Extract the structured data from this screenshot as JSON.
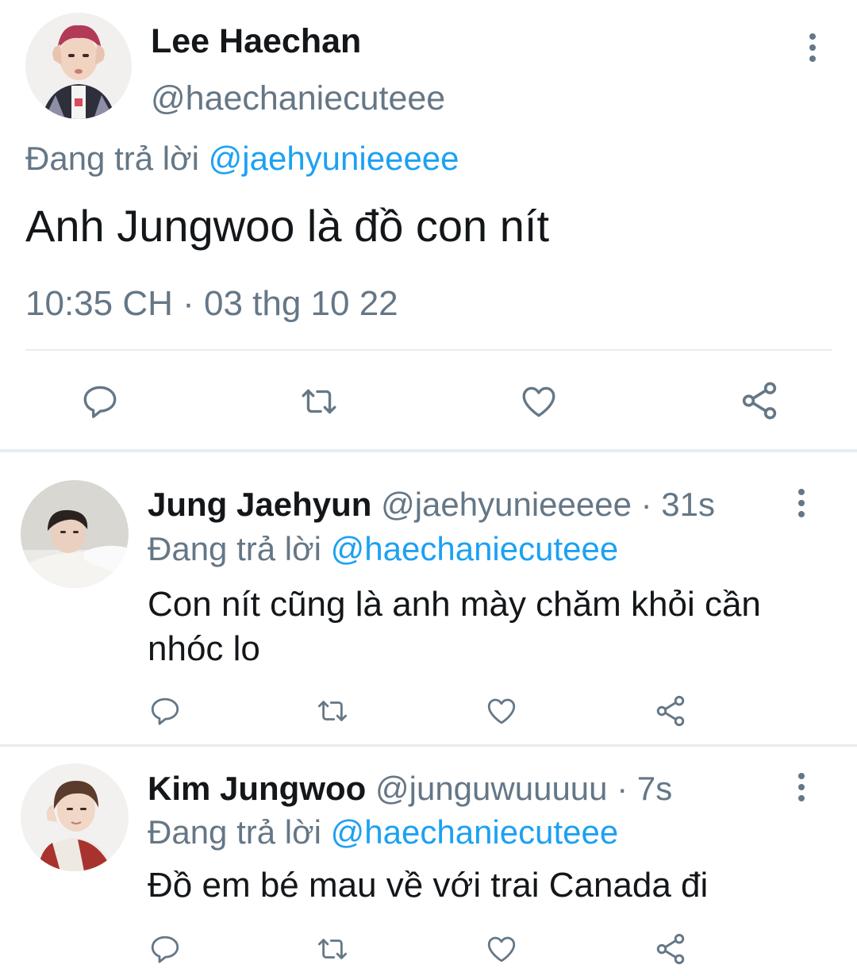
{
  "main_tweet": {
    "author_name": "Lee Haechan",
    "author_handle": "@haechaniecuteee",
    "reply_prefix": "Đang trả lời",
    "reply_to": "@jaehyunieeeee",
    "text": "Anh Jungwoo là đồ con nít",
    "timestamp": "10:35 CH · 03 thg 10 22",
    "actions": [
      "reply-icon",
      "retweet-icon",
      "like-icon",
      "share-icon"
    ]
  },
  "replies": [
    {
      "author_name": "Jung Jaehyun",
      "author_handle": "@jaehyunieeeee",
      "time": " · 31s",
      "reply_prefix": "Đang trả lời",
      "reply_to": "@haechaniecuteee",
      "text": "Con nít cũng là anh mày chăm khỏi cần nhóc lo"
    },
    {
      "author_name": "Kim Jungwoo",
      "author_handle": "@junguwuuuuu",
      "time": " · 7s",
      "reply_prefix": "Đang trả lời",
      "reply_to": "@haechaniecuteee",
      "text": "Đồ em bé mau về với trai Canada đi"
    }
  ],
  "colors": {
    "text": "#14171a",
    "secondary": "#657786",
    "link": "#1da1f2",
    "divider": "#e6ecf0"
  }
}
